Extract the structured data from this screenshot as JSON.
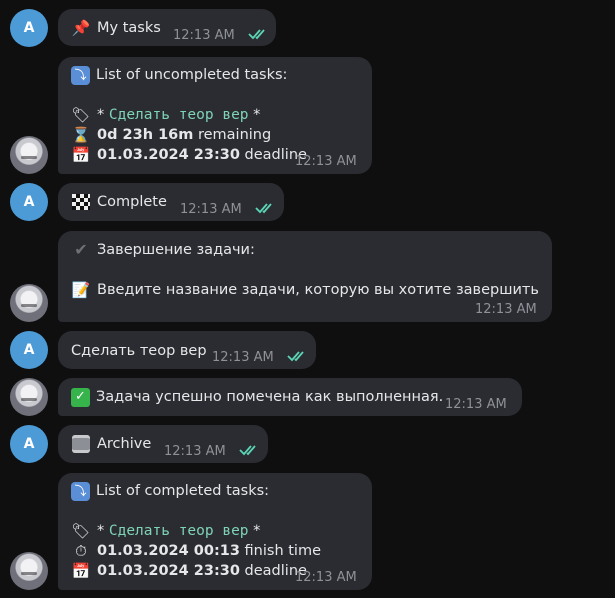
{
  "colors": {
    "background": "#0f0f10",
    "bubble": "#2b2c31",
    "time": "#8e9197",
    "read_ticks": "#5bd5b6",
    "mono": "#7fd3b6",
    "user_avatar": "#4c9bd6"
  },
  "user_avatar_letter": "A",
  "messages": {
    "m1": {
      "icon": "pushpin-icon",
      "text": "My tasks",
      "time": "12:13 AM"
    },
    "m2": {
      "icon": "down-right-arrow-icon",
      "title": "List of uncompleted tasks:",
      "task_prefix": "* ",
      "task_name": "Сделать теор вер",
      "task_suffix": " *",
      "remaining_value": "0d 23h 16m",
      "remaining_label": " remaining",
      "deadline_value": "01.03.2024 23:30",
      "deadline_label": " deadline",
      "time": "12:13 AM"
    },
    "m3": {
      "icon": "checkered-flag-icon",
      "text": "Complete",
      "time": "12:13 AM"
    },
    "m4": {
      "title": "Завершение задачи:",
      "prompt": "Введите название задачи, которую вы хотите завершить",
      "time": "12:13 AM"
    },
    "m5": {
      "text": "Сделать теор вер",
      "time": "12:13 AM"
    },
    "m6": {
      "text": "Задача успешно помечена как выполненная.",
      "time": "12:13 AM"
    },
    "m7": {
      "icon": "archive-icon",
      "text": "Archive",
      "time": "12:13 AM"
    },
    "m8": {
      "title": "List of completed tasks:",
      "task_prefix": "* ",
      "task_name": "Сделать теор вер",
      "task_suffix": " *",
      "finish_value": "01.03.2024 00:13",
      "finish_label": " finish time",
      "deadline_value": "01.03.2024 23:30",
      "deadline_label": " deadline",
      "time": "12:13 AM"
    }
  }
}
